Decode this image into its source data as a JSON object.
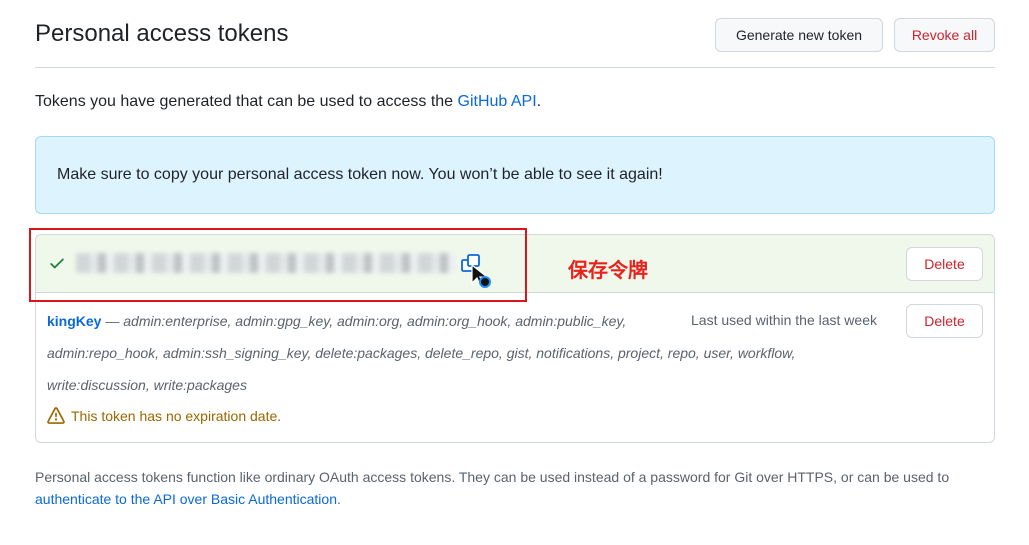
{
  "header": {
    "title": "Personal access tokens",
    "generate_label": "Generate new token",
    "revoke_label": "Revoke all"
  },
  "intro": {
    "text": "Tokens you have generated that can be used to access the ",
    "link": "GitHub API",
    "suffix": "."
  },
  "flash": {
    "message": "Make sure to copy your personal access token now. You won’t be able to see it again!"
  },
  "tokens": [
    {
      "status": "new",
      "value_visible": false,
      "delete_label": "Delete"
    },
    {
      "name": "kingKey",
      "separator": " — ",
      "scopes_line1": "admin:enterprise, admin:gpg_key, admin:org, admin:org_hook, admin:public_key,",
      "scopes_line2": "admin:repo_hook, admin:ssh_signing_key, delete:packages, delete_repo, gist, notifications, project, repo, user, workflow,",
      "scopes_line3": "write:discussion, write:packages",
      "last_used": "Last used within the last week",
      "warning": "This token has no expiration date.",
      "delete_label": "Delete"
    }
  ],
  "annotation": {
    "text": "保存令牌",
    "color": "#e8231d"
  },
  "footer": {
    "text": "Personal access tokens function like ordinary OAuth access tokens. They can be used instead of a password for Git over HTTPS, or can be used to ",
    "link": "authenticate to the API over Basic Authentication",
    "suffix": "."
  },
  "icons": [
    "check-icon",
    "copy-icon",
    "cursor-icon",
    "alert-icon"
  ],
  "colors": {
    "link": "#0969da",
    "danger": "#cf222e",
    "success": "#1a7f37",
    "warning": "#9a6700",
    "flash_bg": "#ddf4ff"
  }
}
